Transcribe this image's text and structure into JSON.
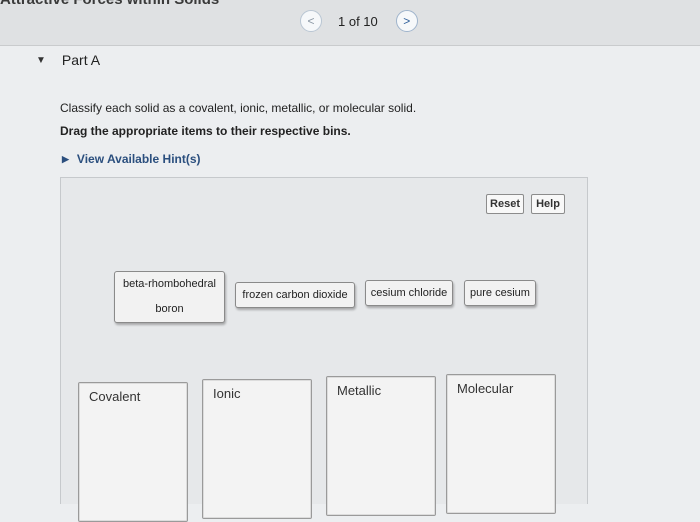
{
  "header": {
    "title": "Attractive Forces within Solids",
    "pager": {
      "prev": "<",
      "count": "1 of 10",
      "next": ">"
    }
  },
  "part": {
    "label": "Part A"
  },
  "instructions": {
    "line1": "Classify each solid as a covalent, ionic, metallic, or molecular solid.",
    "line2": "Drag the appropriate items to their respective bins."
  },
  "hint": {
    "label": "View Available Hint(s)"
  },
  "buttons": {
    "reset": "Reset",
    "help": "Help"
  },
  "items": [
    {
      "line1": "beta-rhombohedral",
      "line2": "boron"
    },
    {
      "label": "frozen carbon dioxide"
    },
    {
      "label": "cesium chloride"
    },
    {
      "label": "pure cesium"
    }
  ],
  "bins": [
    "Covalent",
    "Ionic",
    "Metallic",
    "Molecular"
  ]
}
